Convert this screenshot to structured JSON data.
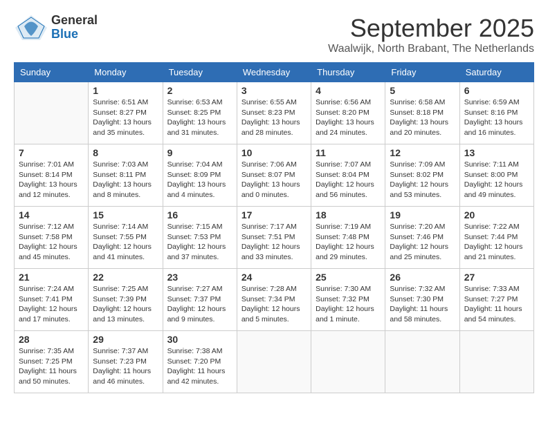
{
  "header": {
    "logo_general": "General",
    "logo_blue": "Blue",
    "month_title": "September 2025",
    "location": "Waalwijk, North Brabant, The Netherlands"
  },
  "weekdays": [
    "Sunday",
    "Monday",
    "Tuesday",
    "Wednesday",
    "Thursday",
    "Friday",
    "Saturday"
  ],
  "weeks": [
    [
      {
        "day": "",
        "info": ""
      },
      {
        "day": "1",
        "info": "Sunrise: 6:51 AM\nSunset: 8:27 PM\nDaylight: 13 hours\nand 35 minutes."
      },
      {
        "day": "2",
        "info": "Sunrise: 6:53 AM\nSunset: 8:25 PM\nDaylight: 13 hours\nand 31 minutes."
      },
      {
        "day": "3",
        "info": "Sunrise: 6:55 AM\nSunset: 8:23 PM\nDaylight: 13 hours\nand 28 minutes."
      },
      {
        "day": "4",
        "info": "Sunrise: 6:56 AM\nSunset: 8:20 PM\nDaylight: 13 hours\nand 24 minutes."
      },
      {
        "day": "5",
        "info": "Sunrise: 6:58 AM\nSunset: 8:18 PM\nDaylight: 13 hours\nand 20 minutes."
      },
      {
        "day": "6",
        "info": "Sunrise: 6:59 AM\nSunset: 8:16 PM\nDaylight: 13 hours\nand 16 minutes."
      }
    ],
    [
      {
        "day": "7",
        "info": "Sunrise: 7:01 AM\nSunset: 8:14 PM\nDaylight: 13 hours\nand 12 minutes."
      },
      {
        "day": "8",
        "info": "Sunrise: 7:03 AM\nSunset: 8:11 PM\nDaylight: 13 hours\nand 8 minutes."
      },
      {
        "day": "9",
        "info": "Sunrise: 7:04 AM\nSunset: 8:09 PM\nDaylight: 13 hours\nand 4 minutes."
      },
      {
        "day": "10",
        "info": "Sunrise: 7:06 AM\nSunset: 8:07 PM\nDaylight: 13 hours\nand 0 minutes."
      },
      {
        "day": "11",
        "info": "Sunrise: 7:07 AM\nSunset: 8:04 PM\nDaylight: 12 hours\nand 56 minutes."
      },
      {
        "day": "12",
        "info": "Sunrise: 7:09 AM\nSunset: 8:02 PM\nDaylight: 12 hours\nand 53 minutes."
      },
      {
        "day": "13",
        "info": "Sunrise: 7:11 AM\nSunset: 8:00 PM\nDaylight: 12 hours\nand 49 minutes."
      }
    ],
    [
      {
        "day": "14",
        "info": "Sunrise: 7:12 AM\nSunset: 7:58 PM\nDaylight: 12 hours\nand 45 minutes."
      },
      {
        "day": "15",
        "info": "Sunrise: 7:14 AM\nSunset: 7:55 PM\nDaylight: 12 hours\nand 41 minutes."
      },
      {
        "day": "16",
        "info": "Sunrise: 7:15 AM\nSunset: 7:53 PM\nDaylight: 12 hours\nand 37 minutes."
      },
      {
        "day": "17",
        "info": "Sunrise: 7:17 AM\nSunset: 7:51 PM\nDaylight: 12 hours\nand 33 minutes."
      },
      {
        "day": "18",
        "info": "Sunrise: 7:19 AM\nSunset: 7:48 PM\nDaylight: 12 hours\nand 29 minutes."
      },
      {
        "day": "19",
        "info": "Sunrise: 7:20 AM\nSunset: 7:46 PM\nDaylight: 12 hours\nand 25 minutes."
      },
      {
        "day": "20",
        "info": "Sunrise: 7:22 AM\nSunset: 7:44 PM\nDaylight: 12 hours\nand 21 minutes."
      }
    ],
    [
      {
        "day": "21",
        "info": "Sunrise: 7:24 AM\nSunset: 7:41 PM\nDaylight: 12 hours\nand 17 minutes."
      },
      {
        "day": "22",
        "info": "Sunrise: 7:25 AM\nSunset: 7:39 PM\nDaylight: 12 hours\nand 13 minutes."
      },
      {
        "day": "23",
        "info": "Sunrise: 7:27 AM\nSunset: 7:37 PM\nDaylight: 12 hours\nand 9 minutes."
      },
      {
        "day": "24",
        "info": "Sunrise: 7:28 AM\nSunset: 7:34 PM\nDaylight: 12 hours\nand 5 minutes."
      },
      {
        "day": "25",
        "info": "Sunrise: 7:30 AM\nSunset: 7:32 PM\nDaylight: 12 hours\nand 1 minute."
      },
      {
        "day": "26",
        "info": "Sunrise: 7:32 AM\nSunset: 7:30 PM\nDaylight: 11 hours\nand 58 minutes."
      },
      {
        "day": "27",
        "info": "Sunrise: 7:33 AM\nSunset: 7:27 PM\nDaylight: 11 hours\nand 54 minutes."
      }
    ],
    [
      {
        "day": "28",
        "info": "Sunrise: 7:35 AM\nSunset: 7:25 PM\nDaylight: 11 hours\nand 50 minutes."
      },
      {
        "day": "29",
        "info": "Sunrise: 7:37 AM\nSunset: 7:23 PM\nDaylight: 11 hours\nand 46 minutes."
      },
      {
        "day": "30",
        "info": "Sunrise: 7:38 AM\nSunset: 7:20 PM\nDaylight: 11 hours\nand 42 minutes."
      },
      {
        "day": "",
        "info": ""
      },
      {
        "day": "",
        "info": ""
      },
      {
        "day": "",
        "info": ""
      },
      {
        "day": "",
        "info": ""
      }
    ]
  ]
}
